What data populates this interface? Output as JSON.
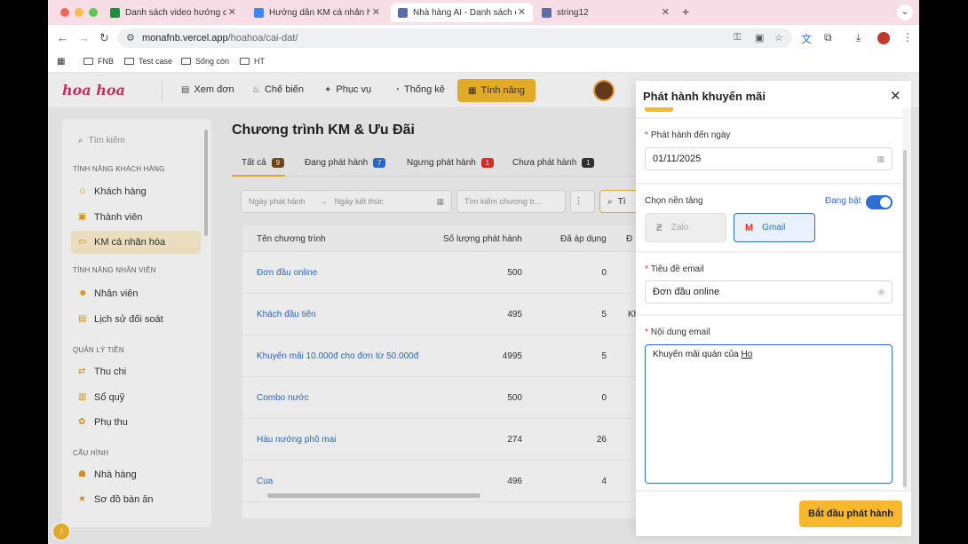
{
  "browser": {
    "tabs": [
      {
        "label": "Danh sách video hướng dẫn",
        "favicon_color": "#1e8e3e"
      },
      {
        "label": "Hướng dẫn KM cá nhân hoá d",
        "favicon_color": "#4285f4"
      },
      {
        "label": "Nhà hàng AI - Danh sách cài",
        "favicon_color": "#5b6ea8"
      },
      {
        "label": "string12",
        "favicon_color": "#5b6ea8"
      }
    ],
    "url_host": "monafnb.vercel.app",
    "url_path": "/hoahoa/cai-dat/",
    "bookmarks": [
      "FNB",
      "Test case",
      "Sống còn",
      "HT"
    ]
  },
  "app": {
    "logo": "hoa hoa",
    "nav": [
      "Xem đơn",
      "Chế biến",
      "Phục vụ",
      "Thống kê",
      "Tính năng"
    ],
    "sidebar": {
      "search_placeholder": "Tìm kiếm",
      "groups": [
        {
          "title": "TÍNH NĂNG KHÁCH HÀNG",
          "items": [
            "Khách hàng",
            "Thành viên",
            "KM cá nhân hóa"
          ]
        },
        {
          "title": "TÍNH NĂNG NHÂN VIÊN",
          "items": [
            "Nhân viên",
            "Lịch sử đối soát"
          ]
        },
        {
          "title": "QUẢN LÝ TIỀN",
          "items": [
            "Thu chi",
            "Sổ quỹ",
            "Phụ thu"
          ]
        },
        {
          "title": "CẤU HÌNH",
          "items": [
            "Nhà hàng",
            "Sơ đồ bàn ăn"
          ]
        }
      ]
    },
    "page_title": "Chương trình KM & Ưu Đãi",
    "filter_tabs": [
      {
        "label": "Tất cả",
        "count": "9",
        "color": "#7a4a1c"
      },
      {
        "label": "Đang phát hành",
        "count": "7",
        "color": "#2f6fd1"
      },
      {
        "label": "Ngưng phát hành",
        "count": "1",
        "color": "#e03131"
      },
      {
        "label": "Chưa phát hành",
        "count": "1",
        "color": "#333333"
      }
    ],
    "filters": {
      "start_placeholder": "Ngày phát hành",
      "end_placeholder": "Ngày kết thúc",
      "search_placeholder": "Tìm kiếm chương tr...",
      "search_button": "Tì"
    },
    "table": {
      "headers": [
        "Tên chương trình",
        "Số lượng phát hành",
        "Đã áp dụng",
        "Đ"
      ],
      "rows": [
        {
          "name": "Đơn đầu online",
          "qty": "500",
          "used": "0",
          "extra": ""
        },
        {
          "name": "Khách đầu tiên",
          "qty": "495",
          "used": "5",
          "extra": "Kh"
        },
        {
          "name": "Khuyến mãi 10.000đ cho đơn từ 50.000đ",
          "qty": "4995",
          "used": "5",
          "extra": ""
        },
        {
          "name": "Combo nước",
          "qty": "500",
          "used": "0",
          "extra": ""
        },
        {
          "name": "Hàu nướng phô mai",
          "qty": "274",
          "used": "26",
          "extra": ""
        },
        {
          "name": "Cua",
          "qty": "496",
          "used": "4",
          "extra": ""
        }
      ]
    }
  },
  "drawer": {
    "title": "Phát hành khuyến mãi",
    "end_date_label": "Phát hành đến ngày",
    "end_date_value": "01/11/2025",
    "platform_label": "Chọn nền tảng",
    "toggle_label": "Đang bật",
    "platforms": [
      "Zalo",
      "Gmail"
    ],
    "email_subject_label": "Tiêu đề email",
    "email_subject_value": "Đơn đầu online",
    "email_body_label": "Nội dung email",
    "email_body_value": "Khuyến mãi quán của ",
    "email_body_cursor_word": "Ho",
    "submit": "Bắt đầu phát hành"
  }
}
